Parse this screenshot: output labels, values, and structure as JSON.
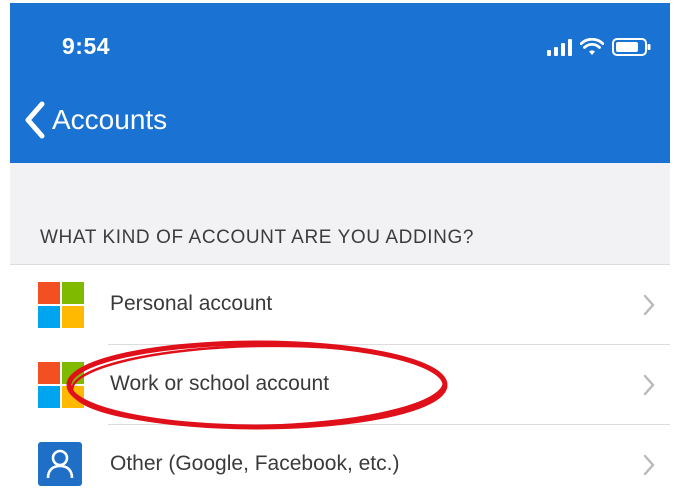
{
  "status_bar": {
    "time": "9:54"
  },
  "nav": {
    "back_label": "Accounts"
  },
  "section": {
    "title": "WHAT KIND OF ACCOUNT ARE YOU ADDING?"
  },
  "accounts": [
    {
      "label": "Personal account",
      "icon": "microsoft-logo-icon"
    },
    {
      "label": "Work or school account",
      "icon": "microsoft-logo-icon"
    },
    {
      "label": "Other (Google, Facebook, etc.)",
      "icon": "person-icon"
    }
  ],
  "colors": {
    "header": "#1a73d2",
    "ms_red": "#f25022",
    "ms_green": "#7fba00",
    "ms_blue": "#00a4ef",
    "ms_yellow": "#ffb900",
    "annotation": "#e0101a"
  }
}
